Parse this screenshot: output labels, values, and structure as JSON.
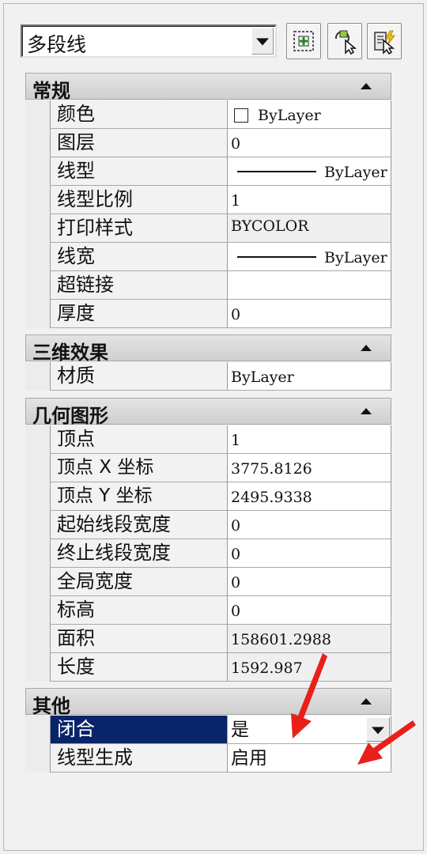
{
  "object_select": {
    "value": "多段线"
  },
  "sections": {
    "general": {
      "title": "常规",
      "rows": [
        {
          "name": "颜色",
          "value": "ByLayer"
        },
        {
          "name": "图层",
          "value": "0"
        },
        {
          "name": "线型",
          "value": "ByLayer"
        },
        {
          "name": "线型比例",
          "value": "1"
        },
        {
          "name": "打印样式",
          "value": "BYCOLOR"
        },
        {
          "name": "线宽",
          "value": "ByLayer"
        },
        {
          "name": "超链接",
          "value": ""
        },
        {
          "name": "厚度",
          "value": "0"
        }
      ]
    },
    "threed": {
      "title": "三维效果",
      "rows": [
        {
          "name": "材质",
          "value": "ByLayer"
        }
      ]
    },
    "geometry": {
      "title": "几何图形",
      "rows": [
        {
          "name": "顶点",
          "value": "1"
        },
        {
          "name": "顶点 X 坐标",
          "value": "3775.8126"
        },
        {
          "name": "顶点 Y 坐标",
          "value": "2495.9338"
        },
        {
          "name": "起始线段宽度",
          "value": "0"
        },
        {
          "name": "终止线段宽度",
          "value": "0"
        },
        {
          "name": "全局宽度",
          "value": "0"
        },
        {
          "name": "标高",
          "value": "0"
        },
        {
          "name": "面积",
          "value": "158601.2988"
        },
        {
          "name": "长度",
          "value": "1592.987"
        }
      ]
    },
    "misc": {
      "title": "其他",
      "rows": [
        {
          "name": "闭合",
          "value": "是"
        },
        {
          "name": "线型生成",
          "value": "启用"
        }
      ]
    }
  },
  "colors": {
    "selection": "#0a246a",
    "annotation_arrow": "#e8201a"
  }
}
